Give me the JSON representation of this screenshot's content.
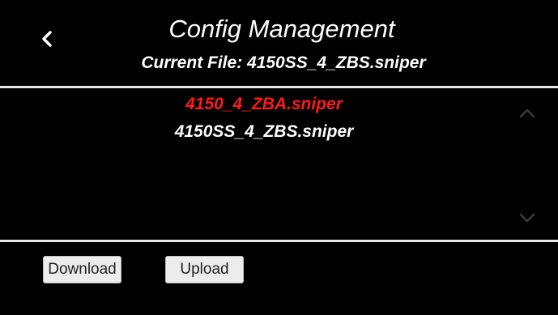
{
  "header": {
    "title": "Config Management",
    "current_file_label": "Current File: 4150SS_4_ZBS.sniper",
    "back_icon": "chevron-left-icon"
  },
  "file_list": {
    "items": [
      {
        "name": "4150_4_ZBA.sniper",
        "selected": true
      },
      {
        "name": "4150SS_4_ZBS.sniper",
        "selected": false
      }
    ],
    "scroll_up_icon": "chevron-up-icon",
    "scroll_down_icon": "chevron-down-icon"
  },
  "footer": {
    "download_label": "Download",
    "upload_label": "Upload"
  },
  "colors": {
    "background": "#000000",
    "selected_item": "#ff1a1a",
    "divider": "#e8e8e8",
    "button_bg": "#ececec",
    "scroll_arrow": "#3a3a3a"
  }
}
